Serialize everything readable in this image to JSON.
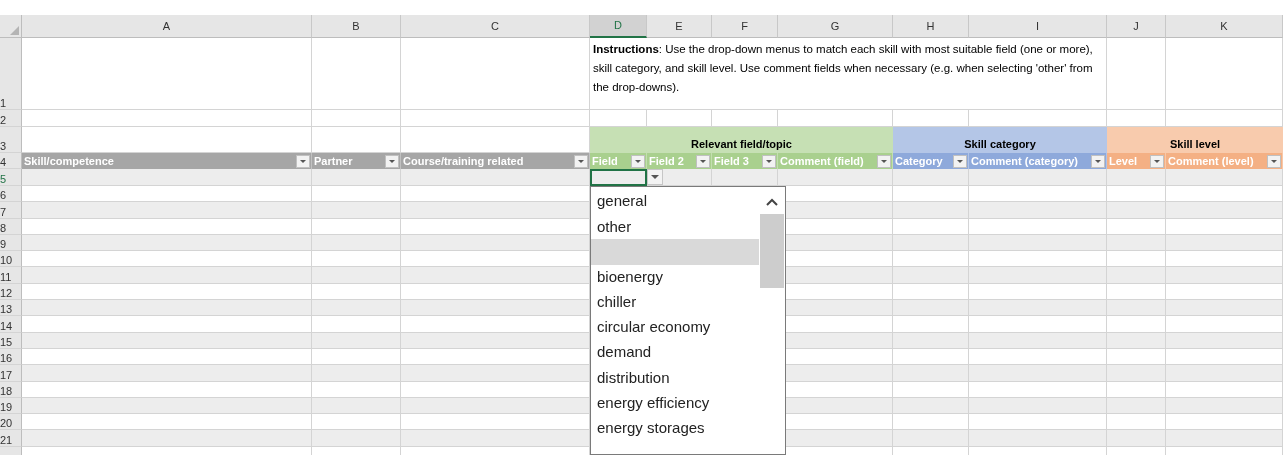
{
  "column_headers": [
    {
      "label": "A",
      "selected": false
    },
    {
      "label": "B",
      "selected": false
    },
    {
      "label": "C",
      "selected": false
    },
    {
      "label": "D",
      "selected": true
    },
    {
      "label": "E",
      "selected": false
    },
    {
      "label": "F",
      "selected": false
    },
    {
      "label": "G",
      "selected": false
    },
    {
      "label": "H",
      "selected": false
    },
    {
      "label": "I",
      "selected": false
    },
    {
      "label": "J",
      "selected": false
    },
    {
      "label": "K",
      "selected": false
    }
  ],
  "row_numbers": [
    "1",
    "2",
    "3",
    "4",
    "5",
    "6",
    "7",
    "8",
    "9",
    "10",
    "11",
    "12",
    "13",
    "14",
    "15",
    "16",
    "17",
    "18",
    "19",
    "20",
    "21"
  ],
  "instructions": "**Instructions**: Use the drop-down menus to match each skill with most suitable field (one or more),  skill category, and skill level. Use comment fields when necessary (e.g. when selecting 'other' from the drop-downs).",
  "groups": [
    {
      "label": "Relevant field/topic",
      "color": "#c6e0b4"
    },
    {
      "label": "Skill category",
      "color": "#b4c6e7"
    },
    {
      "label": "Skill level",
      "color": "#f8cbad"
    }
  ],
  "table_headers": [
    {
      "label": "Skill/competence",
      "color": "#a6a6a6"
    },
    {
      "label": "Partner",
      "color": "#a6a6a6"
    },
    {
      "label": "Course/training related",
      "color": "#a6a6a6"
    },
    {
      "label": "Field",
      "color": "#a9d08e"
    },
    {
      "label": "Field 2",
      "color": "#a9d08e"
    },
    {
      "label": "Field 3",
      "color": "#a9d08e"
    },
    {
      "label": "Comment (field)",
      "color": "#a9d08e"
    },
    {
      "label": "Category",
      "color": "#8ea9db"
    },
    {
      "label": "Comment (category)",
      "color": "#8ea9db"
    },
    {
      "label": "Level",
      "color": "#f4b084"
    },
    {
      "label": "Comment (level)",
      "color": "#f4b084"
    }
  ],
  "dropdown": {
    "items": [
      {
        "kind": "text",
        "label": "general",
        "selected": false
      },
      {
        "kind": "text",
        "label": "other",
        "selected": false
      },
      {
        "kind": "blank",
        "selected": true
      },
      {
        "kind": "text",
        "label": "bioenergy",
        "selected": false
      },
      {
        "kind": "text",
        "label": "chiller",
        "selected": false
      },
      {
        "kind": "text",
        "label": "circular economy",
        "selected": false
      },
      {
        "kind": "text",
        "label": "demand",
        "selected": false
      },
      {
        "kind": "text",
        "label": "distribution",
        "selected": false
      },
      {
        "kind": "text",
        "label": "energy efficiency",
        "selected": false
      },
      {
        "kind": "text",
        "label": "energy storages",
        "selected": false
      }
    ]
  }
}
